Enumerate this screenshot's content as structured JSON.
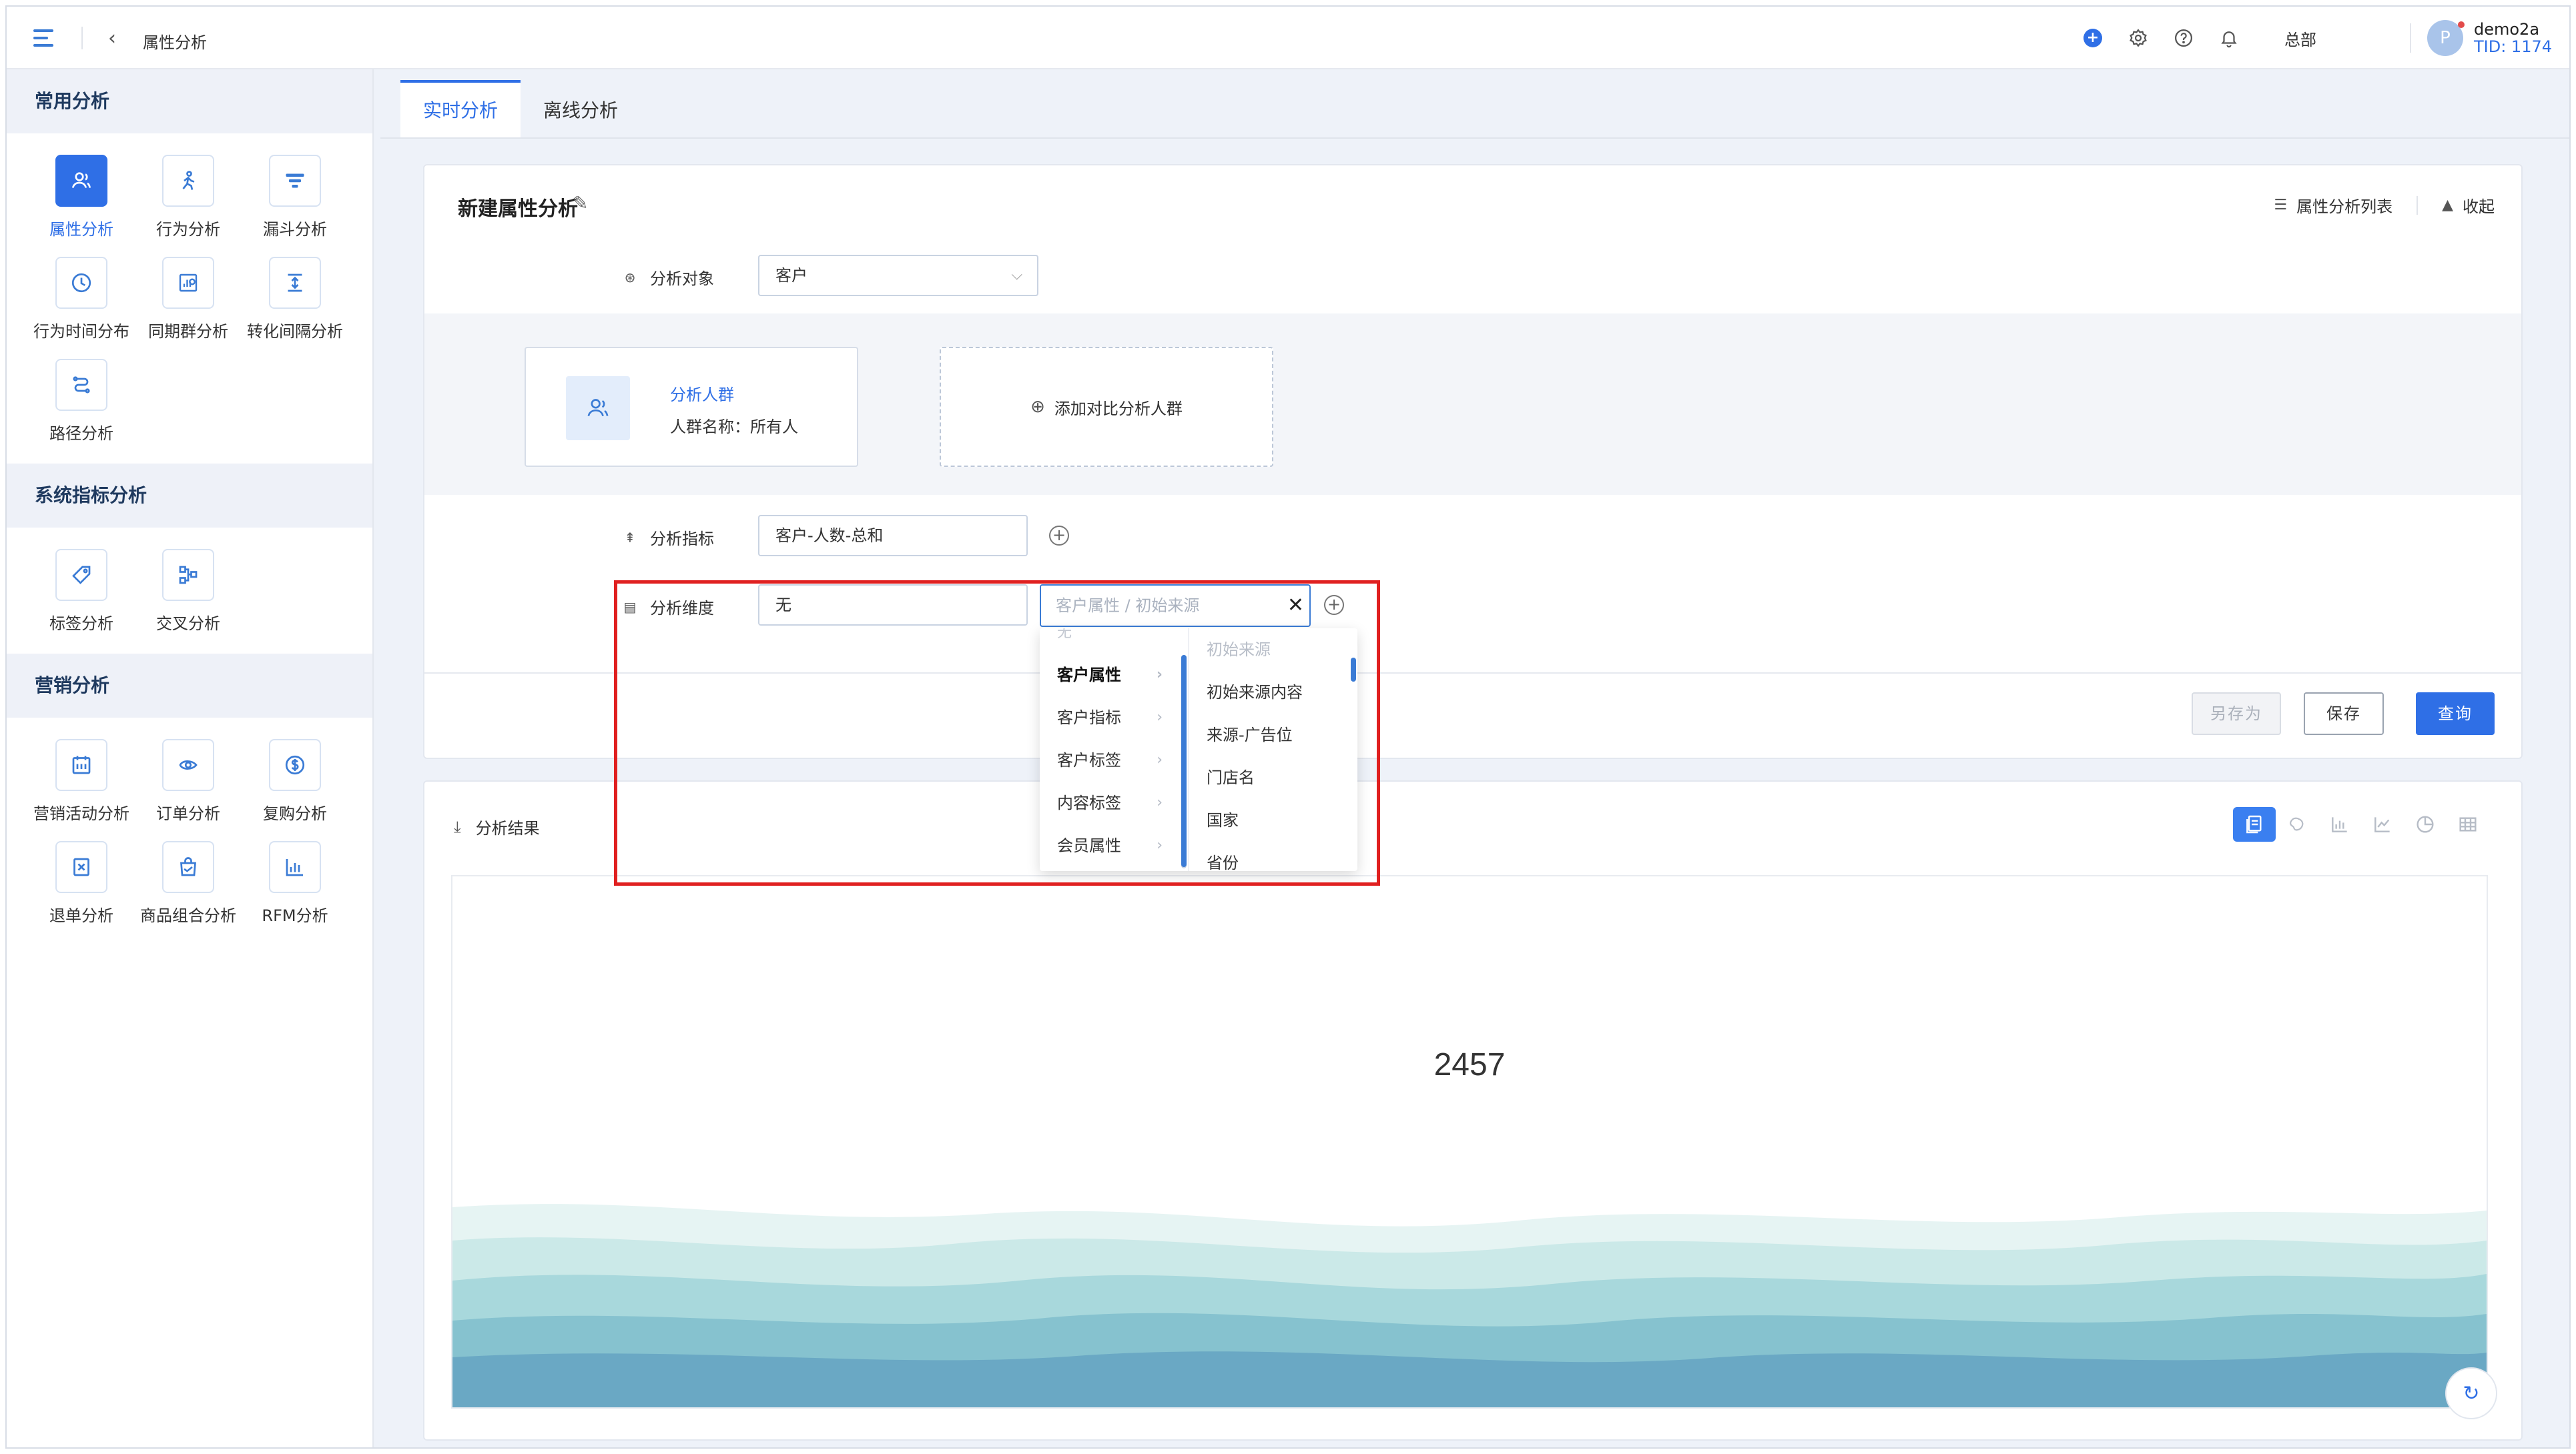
{
  "header": {
    "breadcrumb": "属性分析",
    "org": "总部",
    "user_name": "demo2a",
    "user_tid": "TID: 1174",
    "avatar_letter": "P",
    "notify_badge": "+"
  },
  "sidebar": {
    "sections": [
      {
        "title": "常用分析",
        "items": [
          {
            "label": "属性分析",
            "icon": "user-icon",
            "active": true
          },
          {
            "label": "行为分析",
            "icon": "behavior-icon"
          },
          {
            "label": "漏斗分析",
            "icon": "funnel-icon"
          },
          {
            "label": "行为时间分布",
            "icon": "clock-icon"
          },
          {
            "label": "同期群分析",
            "icon": "cohort-icon"
          },
          {
            "label": "转化间隔分析",
            "icon": "interval-icon"
          },
          {
            "label": "路径分析",
            "icon": "path-icon"
          }
        ]
      },
      {
        "title": "系统指标分析",
        "items": [
          {
            "label": "标签分析",
            "icon": "tag-icon"
          },
          {
            "label": "交叉分析",
            "icon": "cross-icon"
          }
        ]
      },
      {
        "title": "营销分析",
        "items": [
          {
            "label": "营销活动分析",
            "icon": "calendar-icon"
          },
          {
            "label": "订单分析",
            "icon": "order-icon"
          },
          {
            "label": "复购分析",
            "icon": "dollar-icon"
          },
          {
            "label": "退单分析",
            "icon": "refund-icon"
          },
          {
            "label": "商品组合分析",
            "icon": "bag-icon"
          },
          {
            "label": "RFM分析",
            "icon": "bar-chart-icon"
          }
        ]
      }
    ]
  },
  "tabs": [
    {
      "label": "实时分析",
      "active": true
    },
    {
      "label": "离线分析",
      "active": false
    }
  ],
  "config": {
    "title": "新建属性分析",
    "list_link": "属性分析列表",
    "collapse_link": "收起",
    "object_label": "分析对象",
    "object_value": "客户",
    "group_title": "分析人群",
    "group_subtitle": "人群名称：所有人",
    "add_group": "添加对比分析人群",
    "metric_label": "分析指标",
    "metric_value": "客户-人数-总和",
    "dimension_label": "分析维度",
    "dimension_value": "无",
    "dimension_placeholder": "客户属性 / 初始来源",
    "btn_save_as": "另存为",
    "btn_save": "保存",
    "btn_query": "查询"
  },
  "dropdown": {
    "cut_top": "无",
    "categories": [
      {
        "label": "客户属性",
        "selected": true
      },
      {
        "label": "客户指标"
      },
      {
        "label": "客户标签"
      },
      {
        "label": "内容标签"
      },
      {
        "label": "会员属性"
      }
    ],
    "options": [
      {
        "label": "初始来源",
        "dim": true
      },
      {
        "label": "初始来源内容"
      },
      {
        "label": "来源-广告位"
      },
      {
        "label": "门店名"
      },
      {
        "label": "国家"
      },
      {
        "label": "省份"
      }
    ]
  },
  "result": {
    "title": "分析结果",
    "value": "2457",
    "chart_types": [
      "number-card-icon",
      "map-icon",
      "bar-chart-icon",
      "line-chart-icon",
      "pie-chart-icon",
      "table-icon"
    ]
  },
  "colors": {
    "accent": "#2f6fe6",
    "highlight": "#e02020"
  }
}
